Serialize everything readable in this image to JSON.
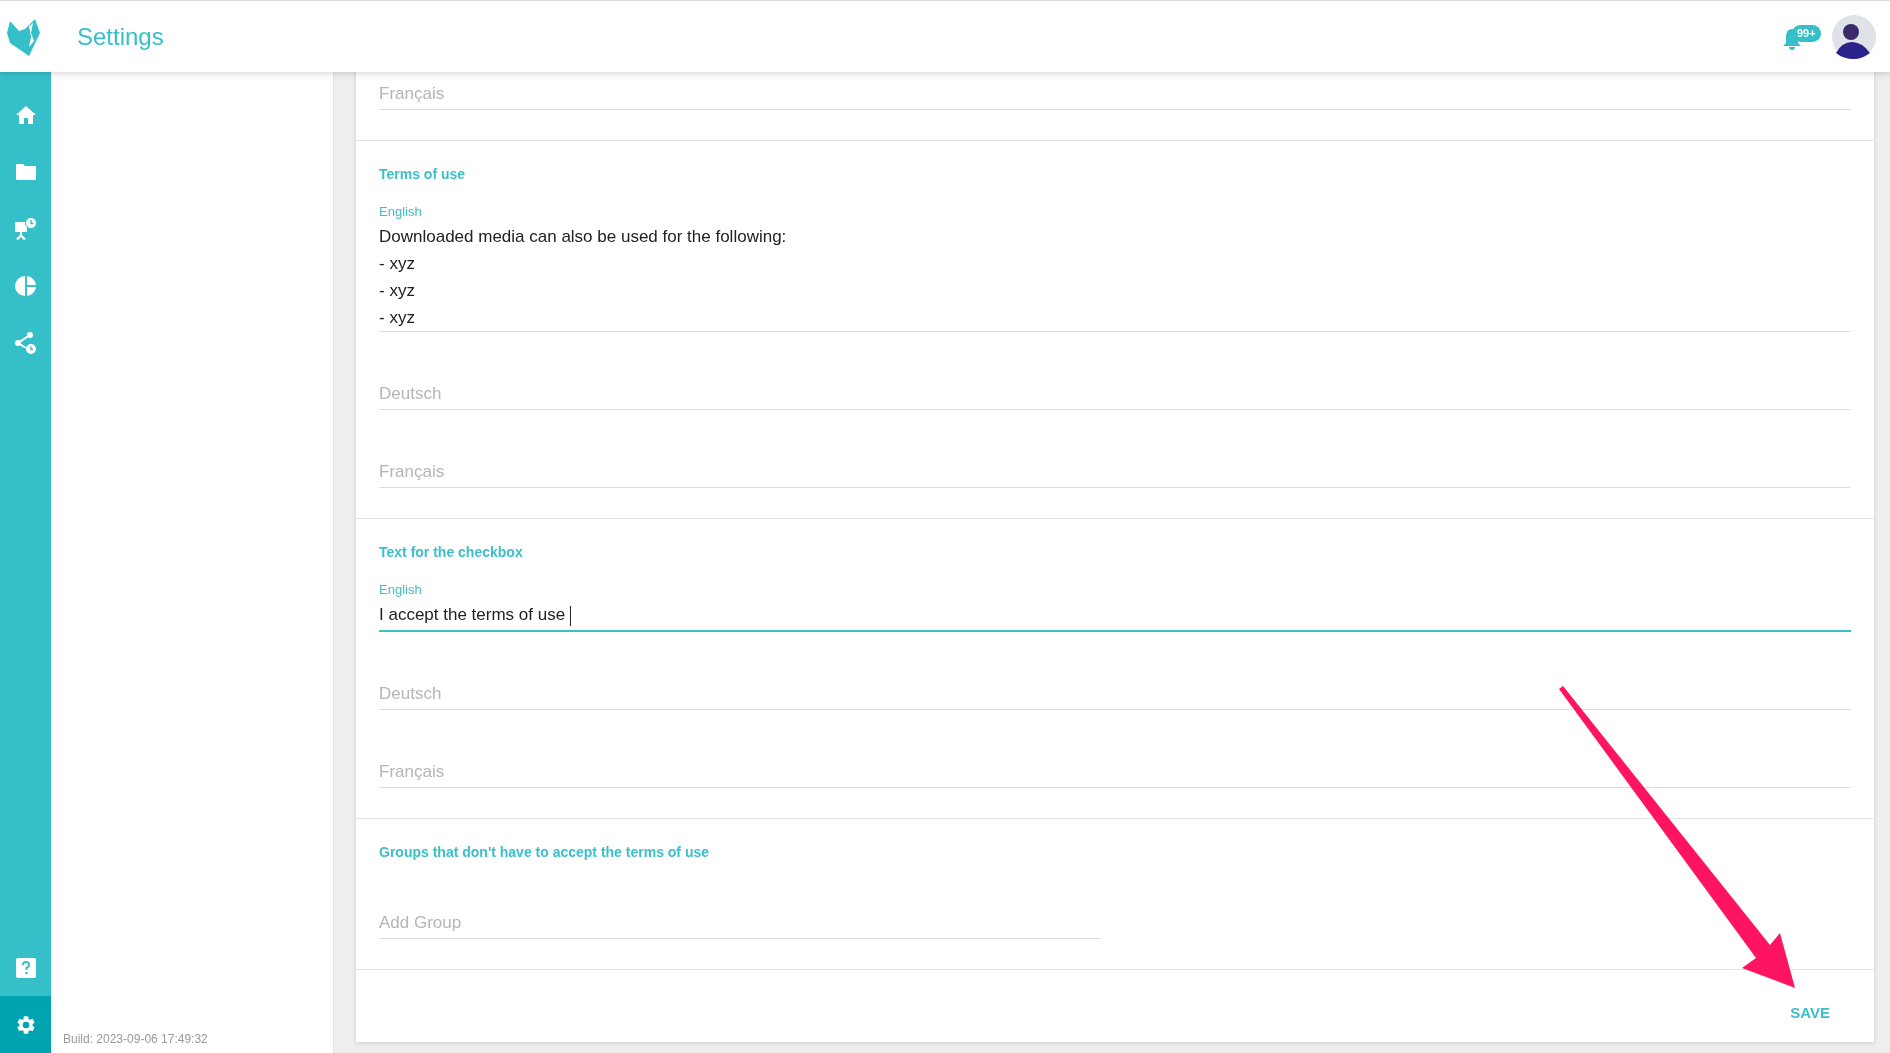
{
  "header": {
    "title": "Settings",
    "notification_count": "99+"
  },
  "sidebar": {
    "items": [
      {
        "kind": "home",
        "selected": false
      },
      {
        "kind": "folder",
        "selected": false
      },
      {
        "kind": "presentation",
        "selected": false
      },
      {
        "kind": "chart",
        "selected": false
      },
      {
        "kind": "share",
        "selected": false
      }
    ],
    "bottom_items": [
      {
        "kind": "help",
        "selected": false
      },
      {
        "kind": "settings",
        "selected": true
      }
    ]
  },
  "build": "Build: 2023-09-06 17:49:32",
  "sections": [
    {
      "fields": [
        {
          "placeholder": "Français",
          "kind": "wide"
        }
      ]
    },
    {
      "title": "Terms of use",
      "fields": [
        {
          "label": "English",
          "value": "Downloaded media can also be used for the following:\n- xyz\n- xyz\n- xyz",
          "focused": false,
          "kind": "wide"
        },
        {
          "placeholder": "Deutsch",
          "kind": "wide"
        },
        {
          "placeholder": "Français",
          "kind": "wide"
        }
      ]
    },
    {
      "title": "Text for the checkbox",
      "fields": [
        {
          "label": "English",
          "value": "I accept the terms of use ",
          "focused": true,
          "kind": "wide"
        },
        {
          "placeholder": "Deutsch",
          "kind": "wide"
        },
        {
          "placeholder": "Français",
          "kind": "wide"
        }
      ]
    },
    {
      "title": "Groups that don't have to accept the terms of use",
      "fields": [
        {
          "placeholder": "Add Group",
          "kind": "narrow"
        }
      ]
    }
  ],
  "save_button": "SAVE"
}
